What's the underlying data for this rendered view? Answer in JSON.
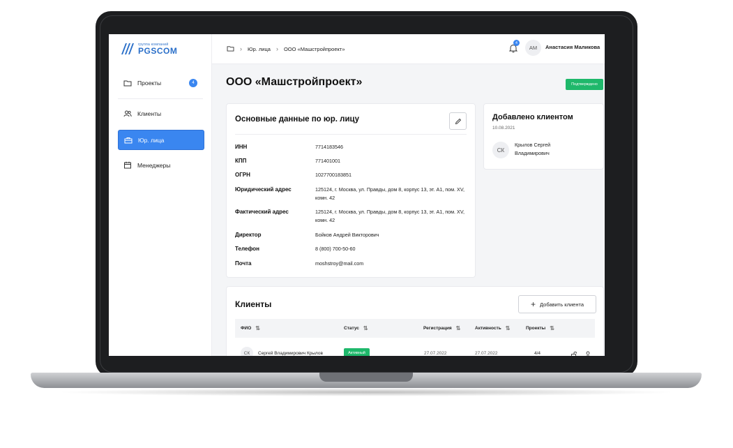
{
  "brand": {
    "top": "группа компаний",
    "name": "PGSCOM"
  },
  "sidebar": {
    "items": [
      {
        "label": "Проекты",
        "icon": "folder-icon",
        "badge": "4",
        "active": false
      },
      {
        "label": "Клиенты",
        "icon": "users-icon",
        "active": false
      },
      {
        "label": "Юр. лица",
        "icon": "briefcase-icon",
        "active": true
      },
      {
        "label": "Менеджеры",
        "icon": "calendar-icon",
        "active": false
      }
    ]
  },
  "topbar": {
    "breadcrumbs": [
      "Юр. лица",
      "ООО «Машстройпроект»"
    ],
    "notifications": "4",
    "user": {
      "initials": "АМ",
      "name": "Анастасия Маликова"
    }
  },
  "page": {
    "title": "ООО «Машстройпроект»",
    "status": "Подтверждено"
  },
  "details": {
    "title": "Основные данные по юр. лицу",
    "rows": [
      {
        "label": "ИНН",
        "value": "7714183546"
      },
      {
        "label": "КПП",
        "value": "771401001"
      },
      {
        "label": "ОГРН",
        "value": "1027700183851"
      },
      {
        "label": "Юридический адрес",
        "value": "125124, г. Москва, ул. Правды, дом 8, корпус 13, эт. А1, пом. XV, комн. 42"
      },
      {
        "label": "Фактический адрес",
        "value": "125124, г. Москва, ул. Правды, дом 8, корпус 13, эт. А1, пом. XV, комн. 42"
      },
      {
        "label": "Директор",
        "value": "Бойков Андрей Викторович"
      },
      {
        "label": "Телефон",
        "value": "8 (800) 700-50-60"
      },
      {
        "label": "Почта",
        "value": "moshstroy@mail.com"
      }
    ]
  },
  "added_by": {
    "title": "Добавлено клиентом",
    "date": "10.08.2021",
    "initials": "СК",
    "name": "Крылов Сергей Владимирович"
  },
  "clients": {
    "title": "Клиенты",
    "add_button": "Добавить клиента",
    "columns": [
      "ФИО",
      "Статус",
      "Регистрация",
      "Активность",
      "Проекты"
    ],
    "rows": [
      {
        "initials": "СК",
        "name": "Сергей Владимирович Крылов",
        "status": "Активный",
        "registered": "27.07.2022",
        "activity": "27.07.2022",
        "projects": "4/4"
      }
    ]
  },
  "colors": {
    "accent": "#3a86f0",
    "success": "#1fb86b"
  }
}
